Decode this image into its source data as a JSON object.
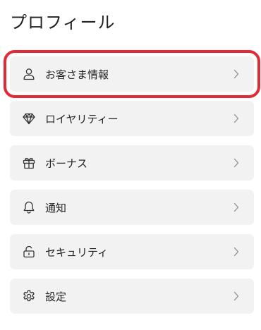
{
  "header": {
    "title": "プロフィール"
  },
  "menu": {
    "items": [
      {
        "label": "お客さま情報",
        "icon": "user-icon",
        "highlighted": true
      },
      {
        "label": "ロイヤリティー",
        "icon": "diamond-icon"
      },
      {
        "label": "ボーナス",
        "icon": "gift-icon"
      },
      {
        "label": "通知",
        "icon": "bell-icon"
      },
      {
        "label": "セキュリティ",
        "icon": "lock-icon"
      },
      {
        "label": "設定",
        "icon": "gear-icon"
      }
    ]
  },
  "colors": {
    "highlight_border": "#e02a35",
    "item_background": "#f2f2f2",
    "chevron": "#9a9a9a"
  }
}
